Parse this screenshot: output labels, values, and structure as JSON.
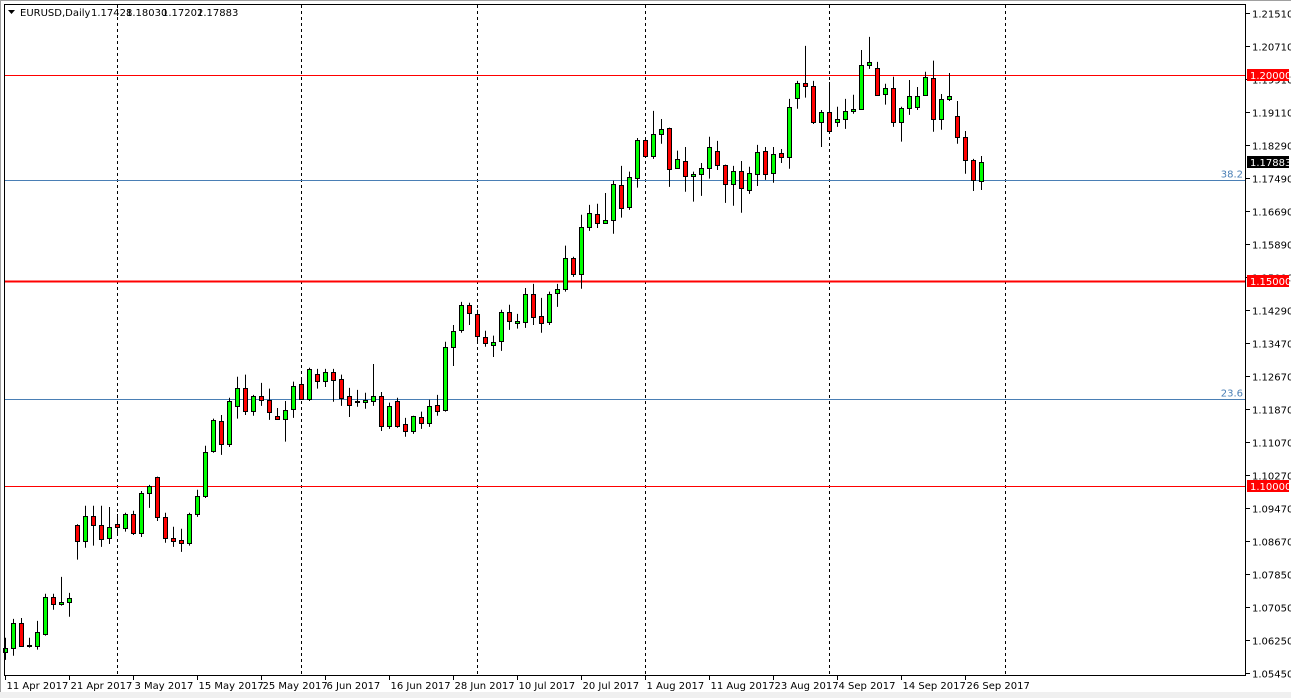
{
  "header": {
    "menu_icon": "triangle-down-icon",
    "symbol_timeframe": "EURUSD,Daily",
    "open": "1.17428",
    "high": "1.18030",
    "low": "1.17202",
    "close": "1.17883"
  },
  "colors": {
    "bull": "#00ff00",
    "bear": "#ff0000",
    "outline": "#000000",
    "level_line": "#ff0000",
    "fib_line": "#4a7fb5",
    "price_tag": "#000000"
  },
  "chart_data": {
    "type": "candlestick",
    "title": "EURUSD,Daily",
    "ylim": [
      1.0545,
      1.2151
    ],
    "grid": false,
    "y_ticks": [
      "1.21510",
      "1.20710",
      "1.19910",
      "1.19110",
      "1.18290",
      "1.17490",
      "1.16690",
      "1.15890",
      "1.15090",
      "1.14290",
      "1.13470",
      "1.12670",
      "1.11870",
      "1.11070",
      "1.10270",
      "1.09470",
      "1.08670",
      "1.07850",
      "1.07050",
      "1.06250",
      "1.05450"
    ],
    "x_ticks": [
      {
        "bar": 0,
        "label": "11 Apr 2017"
      },
      {
        "bar": 8,
        "label": "21 Apr 2017"
      },
      {
        "bar": 16,
        "label": "3 May 2017"
      },
      {
        "bar": 24,
        "label": "15 May 2017"
      },
      {
        "bar": 32,
        "label": "25 May 2017"
      },
      {
        "bar": 40,
        "label": "6 Jun 2017"
      },
      {
        "bar": 48,
        "label": "16 Jun 2017"
      },
      {
        "bar": 56,
        "label": "28 Jun 2017"
      },
      {
        "bar": 64,
        "label": "10 Jul 2017"
      },
      {
        "bar": 72,
        "label": "20 Jul 2017"
      },
      {
        "bar": 80,
        "label": "1 Aug 2017"
      },
      {
        "bar": 88,
        "label": "11 Aug 2017"
      },
      {
        "bar": 96,
        "label": "23 Aug 2017"
      },
      {
        "bar": 104,
        "label": "4 Sep 2017"
      },
      {
        "bar": 112,
        "label": "14 Sep 2017"
      },
      {
        "bar": 120,
        "label": "26 Sep 2017"
      }
    ],
    "period_separators": [
      14,
      37,
      59,
      80,
      103,
      125
    ],
    "levels": [
      {
        "price": 1.2,
        "label": "1.20000",
        "thick": false
      },
      {
        "price": 1.15,
        "label": "1.15000",
        "thick": true
      },
      {
        "price": 1.1,
        "label": "1.10000",
        "thick": false
      }
    ],
    "fib_levels": [
      {
        "price": 1.1745,
        "label": "38.2"
      },
      {
        "price": 1.1212,
        "label": "23.6"
      }
    ],
    "current_price": {
      "price": 1.17883,
      "label": "1.17883"
    },
    "candles_ohlc": [
      [
        1.0597,
        1.0631,
        1.0577,
        1.0606
      ],
      [
        1.0607,
        1.0677,
        1.0587,
        1.0667
      ],
      [
        1.0667,
        1.0679,
        1.0609,
        1.0611
      ],
      [
        1.0611,
        1.0631,
        1.0607,
        1.0614
      ],
      [
        1.0611,
        1.0672,
        1.0602,
        1.0645
      ],
      [
        1.0641,
        1.0738,
        1.0636,
        1.073
      ],
      [
        1.073,
        1.0738,
        1.0699,
        1.0713
      ],
      [
        1.0713,
        1.0779,
        1.0709,
        1.0718
      ],
      [
        1.0718,
        1.074,
        1.0682,
        1.0728
      ],
      [
        1.0906,
        1.0907,
        1.0821,
        1.0867
      ],
      [
        1.0867,
        1.0952,
        1.085,
        1.0928
      ],
      [
        1.0928,
        1.0952,
        1.0855,
        1.0906
      ],
      [
        1.0906,
        1.0952,
        1.0852,
        1.0872
      ],
      [
        1.0874,
        1.0949,
        1.0859,
        1.0901
      ],
      [
        1.0908,
        1.0932,
        1.0884,
        1.0901
      ],
      [
        1.0898,
        1.0935,
        1.0889,
        1.0932
      ],
      [
        1.0932,
        1.094,
        1.0881,
        1.0886
      ],
      [
        1.0886,
        1.0988,
        1.0876,
        1.0984
      ],
      [
        1.0984,
        1.1003,
        1.0947,
        1.1001
      ],
      [
        1.1022,
        1.1023,
        1.0915,
        1.0925
      ],
      [
        1.0925,
        1.0935,
        1.0862,
        1.0874
      ],
      [
        1.0874,
        1.0901,
        1.0852,
        1.0867
      ],
      [
        1.0869,
        1.0896,
        1.084,
        1.0862
      ],
      [
        1.0862,
        1.0935,
        1.0855,
        1.0932
      ],
      [
        1.0932,
        1.0991,
        1.0925,
        1.0976
      ],
      [
        1.0976,
        1.1098,
        1.0971,
        1.1083
      ],
      [
        1.1086,
        1.1164,
        1.1081,
        1.1161
      ],
      [
        1.1159,
        1.1173,
        1.1076,
        1.1103
      ],
      [
        1.1103,
        1.1215,
        1.1095,
        1.1207
      ],
      [
        1.1195,
        1.1266,
        1.1164,
        1.1239
      ],
      [
        1.1239,
        1.1271,
        1.1173,
        1.1183
      ],
      [
        1.1183,
        1.1222,
        1.1171,
        1.122
      ],
      [
        1.122,
        1.1251,
        1.1195,
        1.121
      ],
      [
        1.121,
        1.1237,
        1.1161,
        1.1181
      ],
      [
        1.1171,
        1.119,
        1.1161,
        1.1164
      ],
      [
        1.1164,
        1.1207,
        1.1108,
        1.1186
      ],
      [
        1.1188,
        1.1254,
        1.1166,
        1.1244
      ],
      [
        1.1249,
        1.1258,
        1.1212,
        1.1212
      ],
      [
        1.1212,
        1.1288,
        1.1207,
        1.1285
      ],
      [
        1.1273,
        1.1285,
        1.1237,
        1.1256
      ],
      [
        1.1256,
        1.1285,
        1.1241,
        1.1278
      ],
      [
        1.1278,
        1.1285,
        1.1205,
        1.1258
      ],
      [
        1.1261,
        1.1271,
        1.1195,
        1.1215
      ],
      [
        1.122,
        1.1239,
        1.1168,
        1.1198
      ],
      [
        1.1205,
        1.1234,
        1.1193,
        1.1207
      ],
      [
        1.1205,
        1.1227,
        1.1188,
        1.121
      ],
      [
        1.1207,
        1.1297,
        1.1195,
        1.122
      ],
      [
        1.122,
        1.1229,
        1.1134,
        1.1147
      ],
      [
        1.1147,
        1.1203,
        1.1139,
        1.1195
      ],
      [
        1.1207,
        1.1215,
        1.1142,
        1.1147
      ],
      [
        1.1151,
        1.1166,
        1.112,
        1.1134
      ],
      [
        1.1134,
        1.1171,
        1.1127,
        1.1171
      ],
      [
        1.1168,
        1.1181,
        1.1139,
        1.1154
      ],
      [
        1.1154,
        1.121,
        1.1144,
        1.1195
      ],
      [
        1.1198,
        1.1222,
        1.1171,
        1.1183
      ],
      [
        1.1186,
        1.1351,
        1.1181,
        1.1339
      ],
      [
        1.1339,
        1.1392,
        1.1292,
        1.1378
      ],
      [
        1.138,
        1.1448,
        1.1373,
        1.1441
      ],
      [
        1.1441,
        1.1446,
        1.1392,
        1.1421
      ],
      [
        1.1419,
        1.1429,
        1.1351,
        1.1366
      ],
      [
        1.1363,
        1.1378,
        1.1339,
        1.1348
      ],
      [
        1.1344,
        1.1366,
        1.1314,
        1.1351
      ],
      [
        1.1353,
        1.1429,
        1.1329,
        1.1424
      ],
      [
        1.1424,
        1.1441,
        1.138,
        1.1402
      ],
      [
        1.1397,
        1.1419,
        1.1383,
        1.1402
      ],
      [
        1.14,
        1.1482,
        1.1385,
        1.1468
      ],
      [
        1.1468,
        1.1492,
        1.1392,
        1.1412
      ],
      [
        1.1414,
        1.1458,
        1.1373,
        1.1397
      ],
      [
        1.14,
        1.1473,
        1.1392,
        1.1468
      ],
      [
        1.147,
        1.1492,
        1.1436,
        1.148
      ],
      [
        1.148,
        1.1585,
        1.1473,
        1.1555
      ],
      [
        1.1555,
        1.1558,
        1.1509,
        1.1516
      ],
      [
        1.1516,
        1.166,
        1.148,
        1.1631
      ],
      [
        1.1631,
        1.1684,
        1.1621,
        1.1665
      ],
      [
        1.1662,
        1.1687,
        1.1628,
        1.164
      ],
      [
        1.164,
        1.1713,
        1.1638,
        1.1648
      ],
      [
        1.1648,
        1.1743,
        1.1614,
        1.1735
      ],
      [
        1.1733,
        1.1779,
        1.1653,
        1.1677
      ],
      [
        1.1679,
        1.1765,
        1.1672,
        1.1752
      ],
      [
        1.175,
        1.1847,
        1.1726,
        1.1842
      ],
      [
        1.1842,
        1.1847,
        1.1799,
        1.1804
      ],
      [
        1.1804,
        1.1913,
        1.1796,
        1.1857
      ],
      [
        1.1857,
        1.1893,
        1.1833,
        1.1869
      ],
      [
        1.1872,
        1.1872,
        1.1728,
        1.1772
      ],
      [
        1.1774,
        1.1816,
        1.1772,
        1.1796
      ],
      [
        1.1791,
        1.1825,
        1.1716,
        1.1755
      ],
      [
        1.1755,
        1.1765,
        1.1692,
        1.176
      ],
      [
        1.176,
        1.1786,
        1.1706,
        1.1774
      ],
      [
        1.1774,
        1.185,
        1.1748,
        1.1825
      ],
      [
        1.1816,
        1.184,
        1.1769,
        1.1782
      ],
      [
        1.1782,
        1.1782,
        1.1689,
        1.1735
      ],
      [
        1.1735,
        1.1779,
        1.1682,
        1.1767
      ],
      [
        1.1767,
        1.1791,
        1.1665,
        1.1726
      ],
      [
        1.1721,
        1.1777,
        1.1711,
        1.1762
      ],
      [
        1.176,
        1.183,
        1.173,
        1.1813
      ],
      [
        1.1816,
        1.1825,
        1.1745,
        1.176
      ],
      [
        1.1762,
        1.1825,
        1.1738,
        1.1808
      ],
      [
        1.1811,
        1.182,
        1.1786,
        1.1801
      ],
      [
        1.1801,
        1.1942,
        1.1772,
        1.1923
      ],
      [
        1.1945,
        1.1986,
        1.1918,
        1.1981
      ],
      [
        1.1981,
        1.2071,
        1.1945,
        1.1974
      ],
      [
        1.1974,
        1.1986,
        1.1881,
        1.1886
      ],
      [
        1.1886,
        1.1915,
        1.1825,
        1.1911
      ],
      [
        1.1911,
        1.1983,
        1.1859,
        1.1864
      ],
      [
        1.1886,
        1.1923,
        1.1874,
        1.1893
      ],
      [
        1.1893,
        1.1942,
        1.1869,
        1.1913
      ],
      [
        1.1913,
        1.1952,
        1.1906,
        1.1918
      ],
      [
        1.1918,
        1.2061,
        1.1915,
        1.2025
      ],
      [
        1.2025,
        1.2093,
        1.2015,
        1.2032
      ],
      [
        1.2018,
        1.2032,
        1.1949,
        1.1952
      ],
      [
        1.1954,
        1.1979,
        1.1928,
        1.1969
      ],
      [
        1.1969,
        1.1996,
        1.1874,
        1.1886
      ],
      [
        1.1886,
        1.1923,
        1.1838,
        1.192
      ],
      [
        1.192,
        1.1988,
        1.1903,
        1.1949
      ],
      [
        1.1923,
        1.1971,
        1.1915,
        1.1949
      ],
      [
        1.1952,
        1.2008,
        1.1949,
        1.1996
      ],
      [
        1.1993,
        1.2035,
        1.1862,
        1.1893
      ],
      [
        1.1893,
        1.1954,
        1.1867,
        1.1942
      ],
      [
        1.1942,
        1.2005,
        1.1937,
        1.1949
      ],
      [
        1.1901,
        1.1937,
        1.1833,
        1.185
      ],
      [
        1.185,
        1.1864,
        1.176,
        1.1794
      ],
      [
        1.1794,
        1.1796,
        1.1718,
        1.1745
      ],
      [
        1.17428,
        1.1803,
        1.17202,
        1.17883
      ]
    ]
  }
}
